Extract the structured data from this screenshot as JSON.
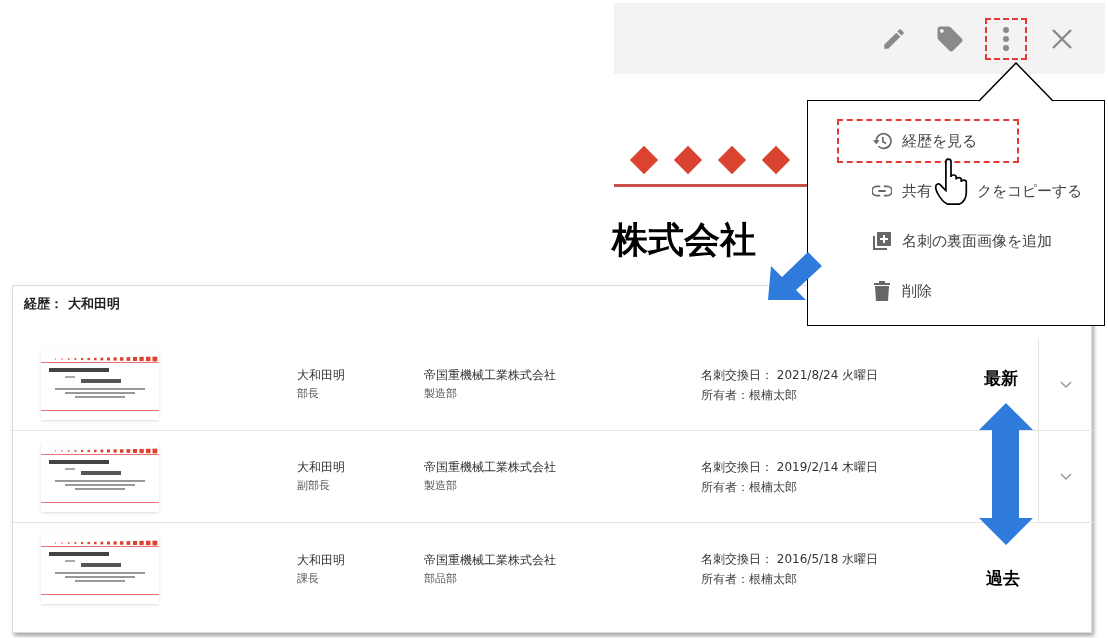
{
  "toolbar": {
    "buttons": [
      {
        "kind": "edit",
        "highlighted": false
      },
      {
        "kind": "tag",
        "highlighted": false
      },
      {
        "kind": "more",
        "highlighted": true
      },
      {
        "kind": "close",
        "highlighted": false
      }
    ]
  },
  "card_preview": {
    "heading": "株式会社"
  },
  "menu": {
    "items": [
      {
        "kind": "history",
        "parts": [
          "経歴を見る"
        ],
        "highlighted": true
      },
      {
        "kind": "link",
        "parts": [
          "共有",
          "クをコピーする"
        ],
        "highlighted": false
      },
      {
        "kind": "add",
        "parts": [
          "名刺の裏面画像を追加"
        ],
        "highlighted": false
      },
      {
        "kind": "delete",
        "parts": [
          "削除"
        ],
        "highlighted": false
      }
    ]
  },
  "history": {
    "title": "経歴： 大和田明",
    "rows": [
      {
        "name": "大和田明",
        "position": "部長",
        "company": "帝国重機械工業株式会社",
        "department": "製造部",
        "exchange_date": "名刺交換日： 2021/8/24 火曜日",
        "owner": "所有者：根楠太郎",
        "expandable": true
      },
      {
        "name": "大和田明",
        "position": "副部長",
        "company": "帝国重機械工業株式会社",
        "department": "製造部",
        "exchange_date": "名刺交換日： 2019/2/14 木曜日",
        "owner": "所有者：根楠太郎",
        "expandable": true
      },
      {
        "name": "大和田明",
        "position": "課長",
        "company": "帝国重機械工業株式会社",
        "department": "部品部",
        "exchange_date": "名刺交換日： 2016/5/18 水曜日",
        "owner": "所有者：根楠太郎",
        "expandable": false
      }
    ]
  },
  "annotations": {
    "newest": "最新",
    "oldest": "過去"
  }
}
